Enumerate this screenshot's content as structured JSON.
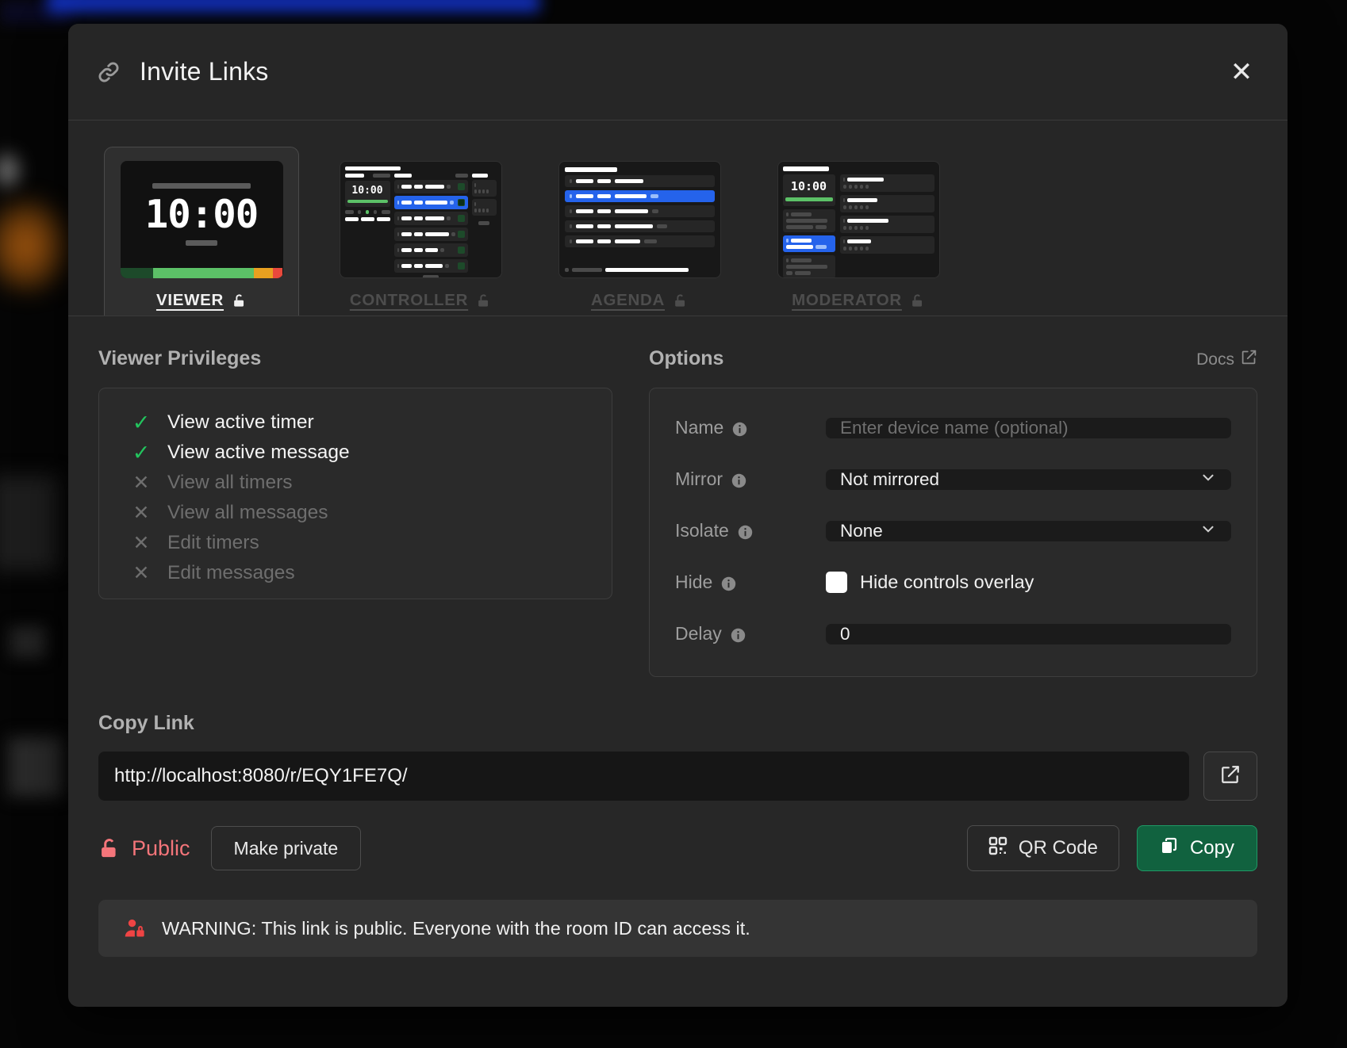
{
  "header": {
    "title": "Invite Links",
    "link_icon": "link-icon",
    "close_icon": "close-icon"
  },
  "tabs": [
    {
      "label": "VIEWER",
      "lock_icon": "unlock-icon",
      "active": true,
      "thumb": "viewer-preview",
      "time": "10:00"
    },
    {
      "label": "CONTROLLER",
      "lock_icon": "unlock-icon",
      "active": false,
      "thumb": "controller-preview",
      "time": "10:00"
    },
    {
      "label": "AGENDA",
      "lock_icon": "unlock-icon",
      "active": false,
      "thumb": "agenda-preview",
      "time": ""
    },
    {
      "label": "MODERATOR",
      "lock_icon": "unlock-icon",
      "active": false,
      "thumb": "moderator-preview",
      "time": "10:00"
    }
  ],
  "privileges": {
    "title": "Viewer Privileges",
    "items": [
      {
        "label": "View active timer",
        "granted": true
      },
      {
        "label": "View active message",
        "granted": true
      },
      {
        "label": "View all timers",
        "granted": false
      },
      {
        "label": "View all messages",
        "granted": false
      },
      {
        "label": "Edit timers",
        "granted": false
      },
      {
        "label": "Edit messages",
        "granted": false
      }
    ]
  },
  "options": {
    "title": "Options",
    "docs_label": "Docs",
    "docs_icon": "external-link-icon",
    "fields": {
      "name": {
        "label": "Name",
        "placeholder": "Enter device name (optional)",
        "value": ""
      },
      "mirror": {
        "label": "Mirror",
        "value": "Not mirrored"
      },
      "isolate": {
        "label": "Isolate",
        "value": "None"
      },
      "hide": {
        "label": "Hide",
        "checkbox_label": "Hide controls overlay",
        "checked": false
      },
      "delay": {
        "label": "Delay",
        "value": "0"
      }
    }
  },
  "copy_link": {
    "title": "Copy Link",
    "url": "http://localhost:8080/r/EQY1FE7Q/",
    "open_icon": "open-external-icon",
    "visibility_label": "Public",
    "visibility_icon": "unlock-icon",
    "make_private_label": "Make private",
    "qr_label": "QR Code",
    "qr_icon": "qr-code-icon",
    "copy_label": "Copy",
    "copy_icon": "copy-icon"
  },
  "warning": {
    "icon": "user-lock-icon",
    "text": "WARNING: This link is public. Everyone with the room ID can access it."
  },
  "colors": {
    "accent_green": "#22c55e",
    "copy_button_bg": "#11623f",
    "danger": "#f4757a",
    "select_blue": "#2563eb",
    "modal_bg": "#272727"
  }
}
